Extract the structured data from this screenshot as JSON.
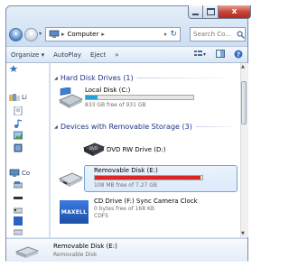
{
  "window": {
    "close_glyph": "x"
  },
  "nav": {
    "breadcrumb_sep": "▸",
    "breadcrumb_item": "Computer",
    "refresh_glyph": "↻",
    "search_placeholder": "Search Co..."
  },
  "toolbar": {
    "organize": "Organize ▾",
    "autoplay": "AutoPlay",
    "eject": "Eject",
    "more": "»"
  },
  "sidebar": {
    "items": [
      {
        "label": "Li",
        "icon": "libraries-icon"
      },
      {
        "label": "Co",
        "icon": "computer-icon"
      }
    ]
  },
  "groups": {
    "hard_drives": "Hard Disk Drives (1)",
    "removable": "Devices with Removable Storage (3)"
  },
  "drives": {
    "local": {
      "name": "Local Disk (C:)",
      "free": "833 GB free of 931 GB",
      "used_fraction": 0.11
    },
    "dvd": {
      "name": "DVD RW Drive (D:)"
    },
    "removable": {
      "name": "Removable Disk (E:)",
      "free": "108 MB free of 7.27 GB",
      "used_fraction": 0.985
    },
    "cd": {
      "name": "CD Drive (F:) Sync Camera Clock",
      "free": "0 bytes free of 168 KB",
      "fs": "CDFS",
      "logo": "MAXELL"
    }
  },
  "details": {
    "title": "Removable Disk (E:)",
    "subtitle": "Removable Disk"
  },
  "colors": {
    "accent": "#1e395b",
    "bar_normal": "#26a0da",
    "bar_full": "#da2626"
  }
}
